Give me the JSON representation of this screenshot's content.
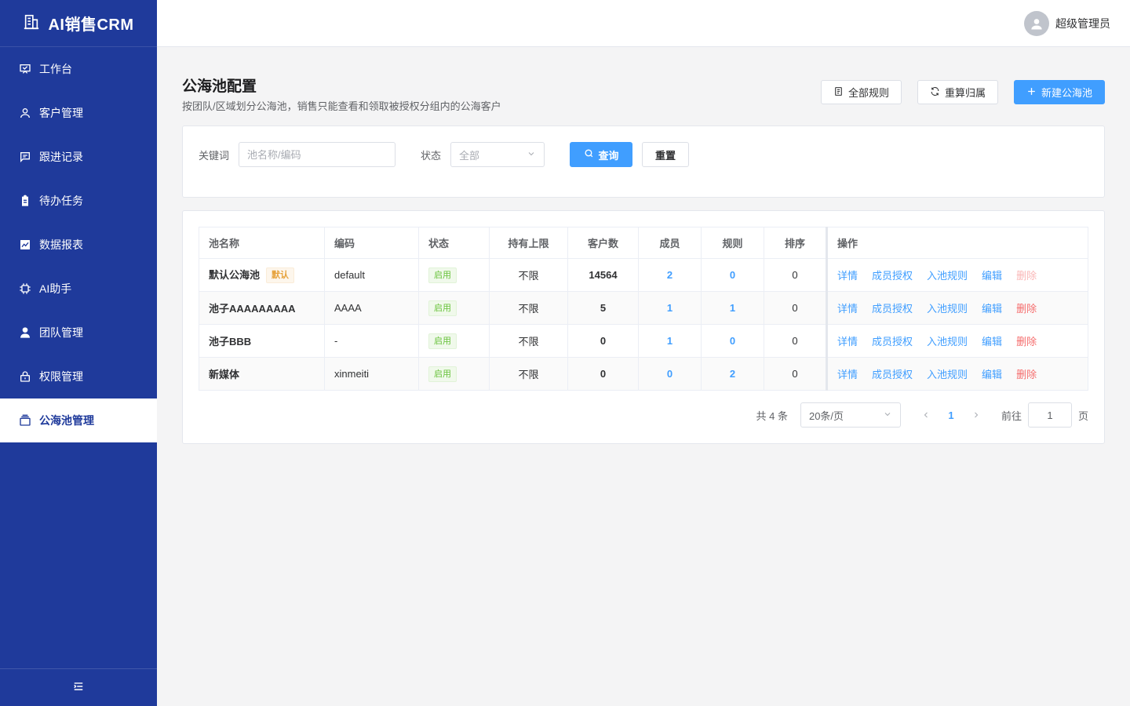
{
  "app": {
    "title": "AI销售CRM"
  },
  "sidebar": {
    "items": [
      {
        "label": "工作台",
        "icon": "dashboard-icon"
      },
      {
        "label": "客户管理",
        "icon": "user-icon"
      },
      {
        "label": "跟进记录",
        "icon": "message-icon"
      },
      {
        "label": "待办任务",
        "icon": "clipboard-icon"
      },
      {
        "label": "数据报表",
        "icon": "chart-icon"
      },
      {
        "label": "AI助手",
        "icon": "cpu-icon"
      },
      {
        "label": "团队管理",
        "icon": "team-icon"
      },
      {
        "label": "权限管理",
        "icon": "lock-icon"
      },
      {
        "label": "公海池管理",
        "icon": "pool-icon",
        "active": true
      }
    ]
  },
  "header": {
    "user_name": "超级管理员"
  },
  "page": {
    "title": "公海池配置",
    "subtitle": "按团队/区域划分公海池，销售只能查看和领取被授权分组内的公海客户"
  },
  "toolbar": {
    "all_rules": "全部规则",
    "recalc": "重算归属",
    "create": "新建公海池"
  },
  "filter": {
    "keyword_label": "关键词",
    "keyword_placeholder": "池名称/编码",
    "status_label": "状态",
    "status_value": "全部",
    "query": "查询",
    "reset": "重置"
  },
  "table": {
    "columns": [
      "池名称",
      "编码",
      "状态",
      "持有上限",
      "客户数",
      "成员",
      "规则",
      "排序",
      "操作"
    ],
    "rows": [
      {
        "name": "默认公海池",
        "default_tag": "默认",
        "code": "default",
        "status": "启用",
        "limit": "不限",
        "customers": "14564",
        "members": "2",
        "rules": "0",
        "sort": "0"
      },
      {
        "name": "池子AAAAAAAAA",
        "code": "AAAA",
        "status": "启用",
        "limit": "不限",
        "customers": "5",
        "members": "1",
        "rules": "1",
        "sort": "0"
      },
      {
        "name": "池子BBB",
        "code": "-",
        "status": "启用",
        "limit": "不限",
        "customers": "0",
        "members": "1",
        "rules": "0",
        "sort": "0"
      },
      {
        "name": "新媒体",
        "code": "xinmeiti",
        "status": "启用",
        "limit": "不限",
        "customers": "0",
        "members": "0",
        "rules": "2",
        "sort": "0"
      }
    ],
    "actions": {
      "detail": "详情",
      "auth": "成员授权",
      "rule": "入池规则",
      "edit": "编辑",
      "delete": "删除"
    }
  },
  "pagination": {
    "total": "共 4 条",
    "page_size": "20条/页",
    "current": "1",
    "goto_label": "前往",
    "goto_value": "1",
    "goto_unit": "页"
  },
  "colors": {
    "sidebar": "#1f3a9b",
    "primary": "#409eff",
    "danger": "#f56c6c",
    "success": "#67c23a",
    "warning": "#e6a23c"
  }
}
